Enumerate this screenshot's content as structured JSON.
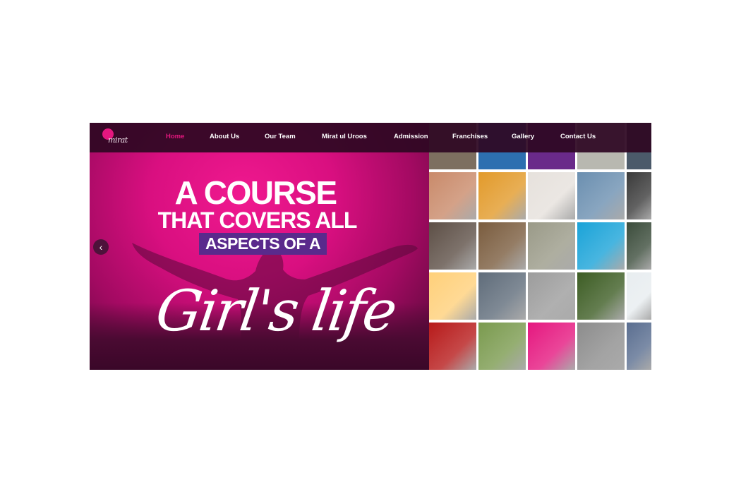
{
  "logo": {
    "icon": "brand-logo",
    "script_text": "mirat"
  },
  "nav": {
    "items": [
      {
        "label": "Home",
        "active": true
      },
      {
        "label": "About Us",
        "active": false
      },
      {
        "label": "Our Team",
        "active": false
      },
      {
        "label": "Mirat ul Uroos",
        "active": false
      },
      {
        "label": "Admission",
        "active": false
      },
      {
        "label": "Franchises",
        "active": false
      },
      {
        "label": "Gallery",
        "active": false
      },
      {
        "label": "Contact Us",
        "active": false
      }
    ]
  },
  "hero": {
    "line1": "A COURSE",
    "line2": "THAT COVERS ALL",
    "line3": "ASPECTS OF A",
    "script": "Girl's life",
    "prev_icon": "chevron-left-icon",
    "colors": {
      "accent": "#e5177f",
      "highlight": "#5a2a8c",
      "nav_bg": "#2e0822"
    }
  },
  "gallery": {
    "tiles": [
      {
        "subject": "woman-face-tile",
        "color": "#c98a6a"
      },
      {
        "subject": "fruits-tile",
        "color": "#e29a2a"
      },
      {
        "subject": "bar-chart-tile",
        "color": "#e6e1dc"
      },
      {
        "subject": "scooter-rider-tile",
        "color": "#6b8fb0"
      },
      {
        "subject": "phone-call-tile",
        "color": "#3a3a3a"
      },
      {
        "subject": "hand-tools-tile",
        "color": "#5d4f46"
      },
      {
        "subject": "cooking-tile",
        "color": "#7a5c3e"
      },
      {
        "subject": "coins-jar-tile",
        "color": "#9a9a88"
      },
      {
        "subject": "swimming-tile",
        "color": "#1aa3d8"
      },
      {
        "subject": "device-hand-tile",
        "color": "#3b4c3b"
      },
      {
        "subject": "lightbulb-tile",
        "color": "#ffd07a"
      },
      {
        "subject": "workshop-tile",
        "color": "#5f6c7a"
      },
      {
        "subject": "brain-hand-tile",
        "color": "#9c9c9c"
      },
      {
        "subject": "fitness-tile",
        "color": "#3d5d24"
      },
      {
        "subject": "first-aid-tile",
        "color": "#e8edf0"
      },
      {
        "subject": "pills-tile",
        "color": "#b71a1a"
      },
      {
        "subject": "yoga-tile",
        "color": "#7a9a4e"
      },
      {
        "subject": "pink-tile",
        "color": "#e5177f"
      },
      {
        "subject": "court-gavel-tile",
        "color": "#8c8c8c"
      },
      {
        "subject": "presentation-tile",
        "color": "#5a6e90"
      }
    ]
  }
}
